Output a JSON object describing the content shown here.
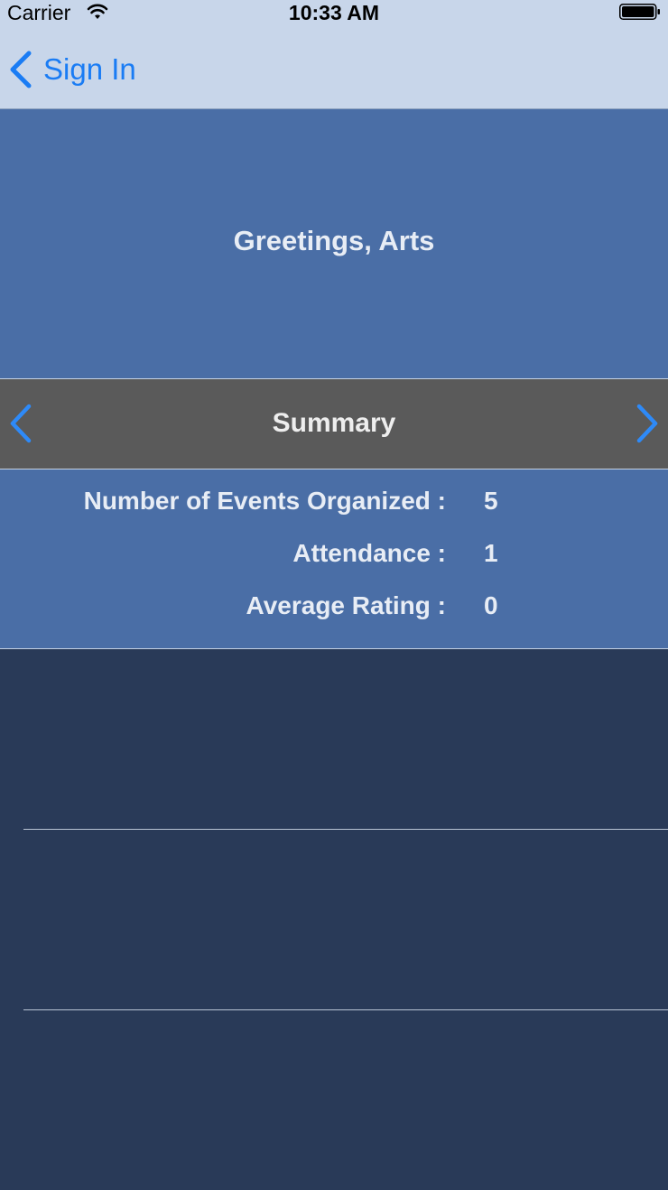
{
  "status_bar": {
    "carrier": "Carrier",
    "time": "10:33 AM",
    "icons": [
      "wifi-icon",
      "battery-icon"
    ]
  },
  "nav": {
    "back_label": "Sign In",
    "back_icon": "chevron-left-icon",
    "accent_color": "#1a7cf4"
  },
  "header": {
    "greeting": "Greetings, Arts",
    "background_color": "#4a6ea6"
  },
  "summary": {
    "title": "Summary",
    "prev_icon": "chevron-left-icon",
    "next_icon": "chevron-right-icon",
    "background_color": "#5a5a5a"
  },
  "stats": [
    {
      "label": "Number of Events Organized :",
      "value": "5"
    },
    {
      "label": "Attendance :",
      "value": "1"
    },
    {
      "label": "Average Rating :",
      "value": "0"
    }
  ],
  "list": {
    "background_color": "#293a58",
    "rows": 3
  }
}
